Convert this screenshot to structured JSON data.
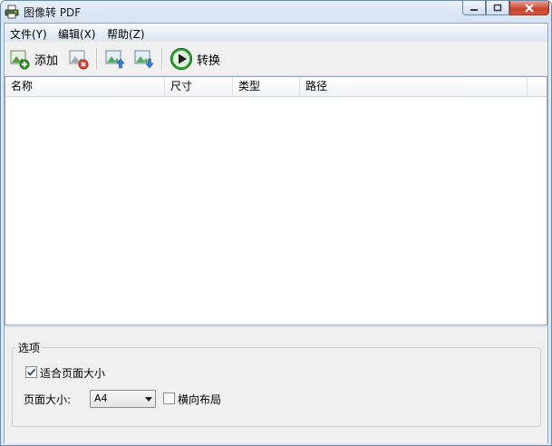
{
  "window": {
    "title": "图像转 PDF"
  },
  "menu": {
    "file": "文件(Y)",
    "edit": "编辑(X)",
    "help": "帮助(Z)"
  },
  "toolbar": {
    "add_label": "添加",
    "convert_label": "转换"
  },
  "list": {
    "columns": [
      "名称",
      "尺寸",
      "类型",
      "路径"
    ],
    "rows": []
  },
  "options": {
    "group_title": "选项",
    "fit_page_label": "适合页面大小",
    "fit_page_checked": true,
    "page_size_label": "页面大小:",
    "page_size_value": "A4",
    "landscape_label": "横向布局",
    "landscape_checked": false
  },
  "colors": {
    "accent": "#3a7bd5",
    "convert": "#2f9a2f",
    "close": "#c8432a"
  },
  "icons": {
    "app": "printer-icon",
    "add": "add-image-icon",
    "remove": "remove-image-icon",
    "move_up": "move-up-icon",
    "move_down": "move-down-icon",
    "convert": "play-icon"
  }
}
